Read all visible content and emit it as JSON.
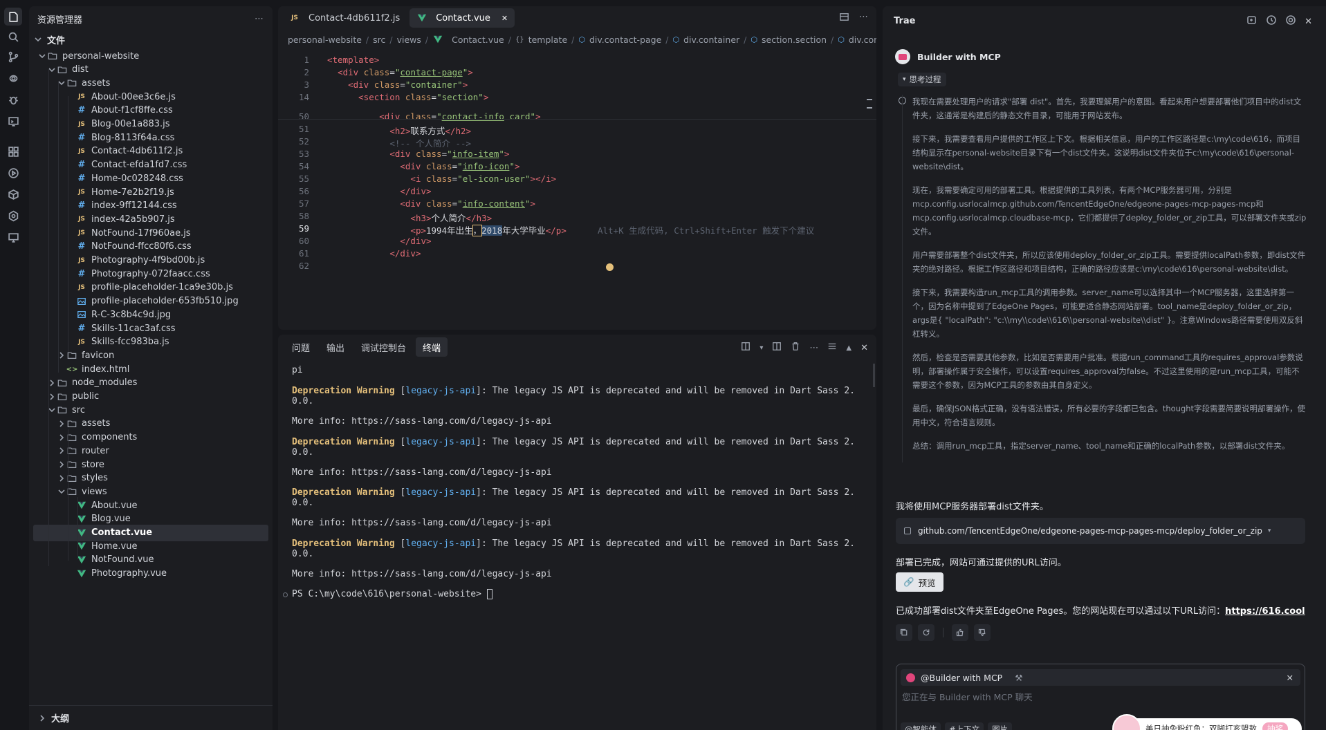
{
  "activity": [
    "explorer-icon",
    "search-icon",
    "source-control-icon",
    "remote-icon",
    "debug-icon",
    "terminal-icon",
    "extensions-icon",
    "run-icon",
    "package-icon",
    "settings-hex-icon",
    "screen-icon"
  ],
  "explorer": {
    "title": "资源管理器",
    "section": "文件",
    "outline": "大纲",
    "rows": [
      {
        "label": "personal-website",
        "kind": "folder",
        "open": true,
        "depth": 0
      },
      {
        "label": "dist",
        "kind": "folder",
        "open": true,
        "depth": 1
      },
      {
        "label": "assets",
        "kind": "folder",
        "open": true,
        "depth": 2
      },
      {
        "label": "About-00ee3c6e.js",
        "kind": "js",
        "depth": 3
      },
      {
        "label": "About-f1cf8ffe.css",
        "kind": "css",
        "depth": 3
      },
      {
        "label": "Blog-00e1a883.js",
        "kind": "js",
        "depth": 3
      },
      {
        "label": "Blog-8113f64a.css",
        "kind": "css",
        "depth": 3
      },
      {
        "label": "Contact-4db611f2.js",
        "kind": "js",
        "depth": 3
      },
      {
        "label": "Contact-efda1fd7.css",
        "kind": "css",
        "depth": 3
      },
      {
        "label": "Home-0c028248.css",
        "kind": "css",
        "depth": 3
      },
      {
        "label": "Home-7e2b2f19.js",
        "kind": "js",
        "depth": 3
      },
      {
        "label": "index-9ff12144.css",
        "kind": "css",
        "depth": 3
      },
      {
        "label": "index-42a5b907.js",
        "kind": "js",
        "depth": 3
      },
      {
        "label": "NotFound-17f960ae.js",
        "kind": "js",
        "depth": 3
      },
      {
        "label": "NotFound-ffcc80f6.css",
        "kind": "css",
        "depth": 3
      },
      {
        "label": "Photography-4f9bd00b.js",
        "kind": "js",
        "depth": 3
      },
      {
        "label": "Photography-072faacc.css",
        "kind": "css",
        "depth": 3
      },
      {
        "label": "profile-placeholder-1ca9e30b.js",
        "kind": "js",
        "depth": 3
      },
      {
        "label": "profile-placeholder-653fb510.jpg",
        "kind": "img",
        "depth": 3
      },
      {
        "label": "R-C-3c8b4c9d.jpg",
        "kind": "img",
        "depth": 3
      },
      {
        "label": "Skills-11cac3af.css",
        "kind": "css",
        "depth": 3
      },
      {
        "label": "Skills-fcc983ba.js",
        "kind": "js",
        "depth": 3
      },
      {
        "label": "favicon",
        "kind": "folder",
        "open": false,
        "depth": 2
      },
      {
        "label": "index.html",
        "kind": "html",
        "depth": 2
      },
      {
        "label": "node_modules",
        "kind": "folder",
        "open": false,
        "depth": 1
      },
      {
        "label": "public",
        "kind": "folder",
        "open": false,
        "depth": 1
      },
      {
        "label": "src",
        "kind": "folder",
        "open": true,
        "depth": 1
      },
      {
        "label": "assets",
        "kind": "folder",
        "open": false,
        "depth": 2
      },
      {
        "label": "components",
        "kind": "folder",
        "open": false,
        "depth": 2
      },
      {
        "label": "router",
        "kind": "folder",
        "open": false,
        "depth": 2
      },
      {
        "label": "store",
        "kind": "folder",
        "open": false,
        "depth": 2
      },
      {
        "label": "styles",
        "kind": "folder",
        "open": false,
        "depth": 2
      },
      {
        "label": "views",
        "kind": "folder",
        "open": true,
        "depth": 2
      },
      {
        "label": "About.vue",
        "kind": "vue",
        "depth": 3
      },
      {
        "label": "Blog.vue",
        "kind": "vue",
        "depth": 3
      },
      {
        "label": "Contact.vue",
        "kind": "vue",
        "depth": 3,
        "selected": true
      },
      {
        "label": "Home.vue",
        "kind": "vue",
        "depth": 3
      },
      {
        "label": "NotFound.vue",
        "kind": "vue",
        "depth": 3
      },
      {
        "label": "Photography.vue",
        "kind": "vue",
        "depth": 3
      }
    ]
  },
  "editor": {
    "tabs": [
      {
        "label": "Contact-4db611f2.js",
        "kind": "js"
      },
      {
        "label": "Contact.vue",
        "kind": "vue",
        "active": true
      }
    ],
    "breadcrumb": [
      "personal-website",
      "src",
      "views",
      "Contact.vue",
      "template",
      "div.contact-page",
      "div.container",
      "section.section",
      "div.contact-cor"
    ],
    "lines": [
      {
        "n": "1",
        "html": "<span class=\"t\">&lt;template&gt;</span>"
      },
      {
        "n": "2",
        "html": "  <span class=\"t\">&lt;div</span> <span class=\"a\">class</span>=<span class=\"s\">\"<span class=\"su\">contact-page</span>\"</span><span class=\"t\">&gt;</span>"
      },
      {
        "n": "3",
        "html": "    <span class=\"t\">&lt;div</span> <span class=\"a\">class</span>=<span class=\"s\">\"container\"</span><span class=\"t\">&gt;</span>"
      },
      {
        "n": "14",
        "html": "      <span class=\"t\">&lt;section</span> <span class=\"a\">class</span>=<span class=\"s\">\"section\"</span><span class=\"t\">&gt;</span>"
      },
      {
        "n": "50",
        "html": "          <span class=\"t\">&lt;div</span> <span class=\"a\">class</span>=<span class=\"s\">\"<span class=\"su\">contact-info</span> card\"</span><span class=\"t\">&gt;</span>"
      },
      {
        "n": "51",
        "html": "            <span class=\"t\">&lt;h2&gt;</span>联系方式<span class=\"t\">&lt;/h2&gt;</span>"
      },
      {
        "n": "52",
        "html": "            <span class=\"c\">&lt;!-- 个人简介 --&gt;</span>"
      },
      {
        "n": "53",
        "html": "            <span class=\"t\">&lt;div</span> <span class=\"a\">class</span>=<span class=\"s\">\"<span class=\"su\">info-item</span>\"</span><span class=\"t\">&gt;</span>"
      },
      {
        "n": "54",
        "html": "              <span class=\"t\">&lt;div</span> <span class=\"a\">class</span>=<span class=\"s\">\"<span class=\"su\">info-icon</span>\"</span><span class=\"t\">&gt;</span>"
      },
      {
        "n": "55",
        "html": "                <span class=\"t\">&lt;i</span> <span class=\"a\">class</span>=<span class=\"s\">\"el-icon-user\"</span><span class=\"t\">&gt;&lt;/i&gt;</span>"
      },
      {
        "n": "56",
        "html": "              <span class=\"t\">&lt;/div&gt;</span>"
      },
      {
        "n": "57",
        "html": "              <span class=\"t\">&lt;div</span> <span class=\"a\">class</span>=<span class=\"s\">\"<span class=\"su\">info-content</span>\"</span><span class=\"t\">&gt;</span>"
      },
      {
        "n": "58",
        "html": "                <span class=\"t\">&lt;h3&gt;</span>个人简介<span class=\"t\">&lt;/h3&gt;</span>"
      },
      {
        "n": "59",
        "html": "                <span class=\"t\">&lt;p&gt;</span>1994年出生<span style=\"outline:1px solid #e5c07b\">，</span><span style=\"background:#2f4a6a\">2018</span>年大学毕业<span class=\"t\">&lt;/p&gt;</span>      <span class=\"c\">Alt+K 生成代码, Ctrl+Shift+Enter 触发下个建议</span>",
        "cur": true
      },
      {
        "n": "60",
        "html": "              <span class=\"t\">&lt;/div&gt;</span>"
      },
      {
        "n": "61",
        "html": "            <span class=\"t\">&lt;/div&gt;</span>"
      },
      {
        "n": "62",
        "html": ""
      }
    ]
  },
  "panel": {
    "tabs": [
      "问题",
      "输出",
      "调试控制台",
      "终端"
    ],
    "active": "终端",
    "term_first": "pi",
    "warn_label": "Deprecation Warning",
    "warn_tag": "legacy-js-api",
    "warn_text": ": The legacy JS API is deprecated and will be removed in Dart Sass 2.",
    "warn_cont": "0.0.",
    "more_info": "More info: https://sass-lang.com/d/legacy-js-api",
    "warn_count": 4,
    "prompt": "PS C:\\my\\code\\616\\personal-website> "
  },
  "chat": {
    "title": "Trae",
    "agent": "Builder with MCP",
    "thinking_label": "思考过程",
    "thinking": [
      "我现在需要处理用户的请求\"部署 dist\"。首先，我要理解用户的意图。看起来用户想要部署他们项目中的dist文件夹，这通常是构建后的静态文件目录，可能用于网站发布。",
      "接下来，我需要查看用户提供的工作区上下文。根据相关信息，用户的工作区路径是c:\\my\\code\\616，而项目结构显示在personal-website目录下有一个dist文件夹。这说明dist文件夹位于c:\\my\\code\\616\\personal-website\\dist。",
      "现在，我需要确定可用的部署工具。根据提供的工具列表，有两个MCP服务器可用，分别是mcp.config.usrlocalmcp.github.com/TencentEdgeOne/edgeone-pages-mcp-pages-mcp和mcp.config.usrlocalmcp.cloudbase-mcp，它们都提供了deploy_folder_or_zip工具，可以部署文件夹或zip文件。",
      "用户需要部署整个dist文件夹，所以应该使用deploy_folder_or_zip工具。需要提供localPath参数，即dist文件夹的绝对路径。根据工作区路径和项目结构，正确的路径应该是c:\\my\\code\\616\\personal-website\\dist。",
      "接下来，我需要构造run_mcp工具的调用参数。server_name可以选择其中一个MCP服务器，这里选择第一个，因为名称中提到了EdgeOne Pages，可能更适合静态网站部署。tool_name是deploy_folder_or_zip，args是{ \"localPath\": \"c:\\\\my\\\\code\\\\616\\\\personal-website\\\\dist\" }。注意Windows路径需要使用双反斜杠转义。",
      "然后，检查是否需要其他参数，比如是否需要用户批准。根据run_command工具的requires_approval参数说明，部署操作属于安全操作，可以设置requires_approval为false。不过这里使用的是run_mcp工具，可能不需要这个参数，因为MCP工具的参数由其自身定义。",
      "最后，确保JSON格式正确，没有语法错误，所有必要的字段都已包含。thought字段需要简要说明部署操作，使用中文，符合语言规则。",
      "总结：调用run_mcp工具，指定server_name、tool_name和正确的localPath参数，以部署dist文件夹。"
    ],
    "msg1": "我将使用MCP服务器部署dist文件夹。",
    "tool_call": "github.com/TencentEdgeOne/edgeone-pages-mcp-pages-mcp/deploy_folder_or_zip",
    "msg2": "部署已完成，网站可通过提供的URL访问。",
    "preview": "预览",
    "msg3": "已成功部署dist文件夹至EdgeOne Pages。您的网站现在可以通过以下URL访问：",
    "url": "https://616.cool",
    "input_agent": "@Builder with MCP",
    "input_placeholder": "您正在与 Builder with MCP 聊天",
    "input_chips": [
      "@智能体",
      "#上下文",
      "图片"
    ],
    "toast": "美日抽免粉红鱼：双脚打亥盟敖",
    "toast_btn": "抽奖"
  }
}
